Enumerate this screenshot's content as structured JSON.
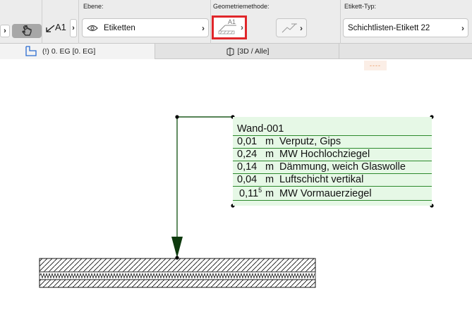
{
  "toolbar": {
    "group_layer": "Ebene:",
    "group_geometry": "Geometriemethode:",
    "group_label_type": "Etikett-Typ:",
    "text_tool_label": "A1",
    "layer_value": "Etiketten",
    "geometry_icon_label": "A1",
    "label_type_value": "Schichtlisten-Etikett 22"
  },
  "tabs": [
    {
      "label": "(!) 0. EG [0. EG]"
    },
    {
      "label": "[3D / Alle]"
    }
  ],
  "marker": "----",
  "label_block": {
    "title": "Wand-001",
    "rows": [
      {
        "thickness": "0,01",
        "unit": "m",
        "material": "Verputz, Gips"
      },
      {
        "thickness": "0,24",
        "unit": "m",
        "material": "MW Hochlochziegel"
      },
      {
        "thickness": "0,14",
        "unit": "m",
        "material": "Dämmung, weich Glaswolle"
      },
      {
        "thickness": "0,04",
        "unit": "m",
        "material": "Luftschicht vertikal"
      },
      {
        "thickness": "0,11",
        "sup": "5",
        "unit": "m",
        "material": "MW Vormauerziegel"
      }
    ]
  },
  "colors": {
    "label_fill": "#e6f8e6",
    "label_lines": "#2d8a2d",
    "leader": "#1f5a1f",
    "highlight": "#e0262a"
  }
}
